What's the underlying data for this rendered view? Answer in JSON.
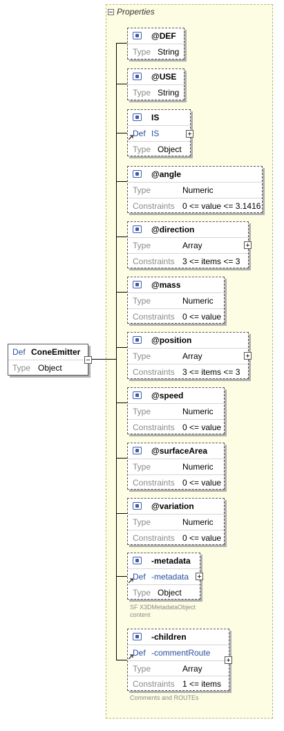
{
  "properties_label": "Properties",
  "root": {
    "def_label": "Def",
    "name": "ConeEmitter",
    "type_label": "Type",
    "type_value": "Object"
  },
  "labels": {
    "type": "Type",
    "constraints": "Constraints",
    "def": "Def"
  },
  "nodes": [
    {
      "name": "@DEF",
      "type": "String"
    },
    {
      "name": "@USE",
      "type": "String"
    },
    {
      "name": "IS",
      "def": "IS",
      "type": "Object"
    },
    {
      "name": "@angle",
      "type": "Numeric",
      "constraints": "0 <= value <= 3.1416"
    },
    {
      "name": "@direction",
      "type": "Array",
      "constraints": "3 <= items <= 3"
    },
    {
      "name": "@mass",
      "type": "Numeric",
      "constraints": "0 <= value"
    },
    {
      "name": "@position",
      "type": "Array",
      "constraints": "3 <= items <= 3"
    },
    {
      "name": "@speed",
      "type": "Numeric",
      "constraints": "0 <= value"
    },
    {
      "name": "@surfaceArea",
      "type": "Numeric",
      "constraints": "0 <= value"
    },
    {
      "name": "@variation",
      "type": "Numeric",
      "constraints": "0 <= value"
    },
    {
      "name": "-metadata",
      "def": "-metadata",
      "type": "Object",
      "caption_1": "SF X3DMetadataObject",
      "caption_2": "content"
    },
    {
      "name": "-children",
      "def": "-commentRoute",
      "type": "Array",
      "constraints": "1 <= items",
      "caption_1": "Comments and ROUTEs"
    }
  ]
}
